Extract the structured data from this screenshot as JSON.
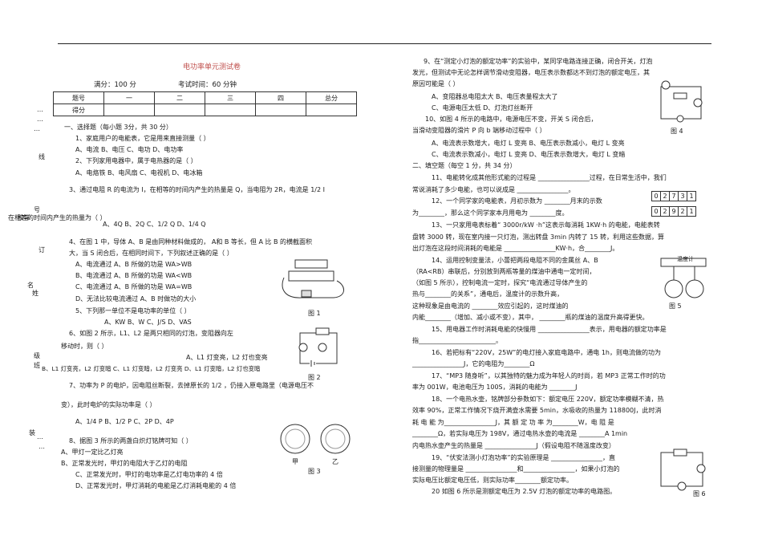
{
  "title": "电功率单元测试卷",
  "meta": {
    "score": "满分：100  分",
    "time": "考试时间：60 分钟"
  },
  "score_table": {
    "header": [
      "题号",
      "一",
      "二",
      "三",
      "四",
      "总分"
    ],
    "row": [
      "得分",
      "",
      "",
      "",
      "",
      ""
    ]
  },
  "binding": {
    "labels": [
      "线",
      "号",
      "订",
      "名",
      "姓",
      "级",
      "班",
      "装",
      "校学"
    ],
    "dots": "…"
  },
  "left_column": [
    "一、选择题（每小题  3分，共 30 分）",
    "1、家庭用户的电能表，它是用来直接测量（            ）",
    "A、电流              B、电压              C、电功              D、电功率",
    "2、下列家用电器中，属于电热器的是（         ）",
    "A、电烙铁            B、电风扇            C、电视机            D、电冰箱",
    "3、通过电阻 R 的电流为 I，在相等的时间内产生的热量是      Q，当电阻为 2R，电流是   1/2 I",
    "在相等的时间内产生的热量为（          ）",
    "A、4Q          B、2Q          C、1/2 Q          D、1/4 Q",
    "4、在图 1 中，导体 A、B 是由同种材料做成的，     A和 B 等长，但 A 比 B 的横截面积",
    "大，当 S 闭合后，在相同时间下，下列叙述正确的是（              ）",
    "A、电流通过  A、B 所做的功是 WA>WB",
    "B、电流通过  A、B 所做的功是 WA<WB",
    "C、电流通过  A、B 所做的功是 WA=WB",
    "D、无法比较电流通过  A、B 时做功的大小",
    "5、下列那一单位不是电功率的单位（          ）",
    "A、KW    B、W           C、J/S          D、VAS",
    "6、如图 2 所示，L1、L2 是两只相同的灯泡，变阻器向左",
    "移动时，则（          ）",
    "A、L1 灯变亮，L2 灯也变亮",
    "B、L1 灯变亮，L2 灯变暗      C、L1 灯变暗，L2 灯变亮      D、L1 灯变暗，L2 灯也变暗",
    "7、功率为  P 的电炉，因电阻丝断裂，去掉原长的       1/2 ，仍接入原电路里（电源电压不",
    "变），此时电炉的实际功率是（          ）",
    "A、1/4 P          B、1/2 P          C、2P          D、4P",
    "8、据图 3 所示的两盏白炽灯铭牌可知（          ）",
    "A、甲灯一定比乙灯亮",
    "B、正常发光时，甲灯的电阻大于乙灯的电阻",
    "C、正常发光时，甲灯的电功率是乙灯电功率的       4 倍",
    "D、正常发光时，甲灯消耗的电能是乙灯消耗电能的       4 倍"
  ],
  "right_column": [
    "9、在“测定小灯泡的额定功率”的实验中，某同学电路连接正确，闭合开关，灯泡",
    "发光，但测试中无论怎样调节滑动变阻器，电压表示数都达不到灯泡的额定电压，其",
    "原因可能是（          ）",
    "A、变阻器总电阻太大          B、电压表量程太大了",
    "C、电源电压太低              D、灯泡灯丝断开",
    "10、如图 4 所示的电路中，电源电压不变，开关    S 闭合后，",
    "当滑动变阻器的滑片  P 向 b 端移动过程中（          ）",
    "A、电流表示数增大，电灯  L 变亮              B、电压表示数减小，电灯  L 变亮",
    "C、电流表示数减小，电灯  L 变亮              D、电压表示数增大，电灯  L 变暗",
    "二、填空题（每空 1 分，共 34 分）",
    "11、电能转化成其他形式能的过程是  ________________过程，在日常生活中，我们",
    "常说消耗了多少电能，也可以说成是  ________________。",
    "12、一个同学家的电能表，月初示数为  ________月末的示数",
    "为________，那么这个同学家本月用电为  ________度。",
    "13、一只家用电表标着“  3000r/kW ·h”这表示每消耗   1KW·h 的电能，电能表转",
    "盘转 3000 转，现在室内接一只灯泡，测出转盘    3min  内转了  15 转，利用这些数据，算",
    "出灯泡在这段时间消耗的电能是  ________________KW·h，合________J。",
    "14、运用控制变量法，小蕾把两段电阻不同的金属丝     A、B",
    "（RA<RB）串联后，分别放到两瓶等量的煤油中通电一定时间，",
    "（如图 5 所示），控制电流一定时，探究“电流通过导体产生的",
    "热与________的关系”，通电后，温度计的示数升高，",
    "这种现象是由电流的  ________效应引起的，这时煤油的",
    "内能________（增加、减小或不变），其中，  ________瓶的煤油的温度升高得更快。",
    "15、用电器工作时消耗电能的快慢用  ________________表示，用电器的额定功率是",
    "指________________________。",
    "16、若把标有“220V，25W”的电灯接入家庭电路中，通电     1h，则电流做的功为",
    "________________J，它的电阻为________Ω",
    "17、“MP3 随身听”，以其独特的魅力成为年轻人的时尚，若       MP3  正常工作时的功",
    "率为 001W，电池电压为 100S，消耗的电能为  ________J",
    "18、一个电热水壶，铭牌部分参数如下：额定电压        220V，额定功率模糊不清，热",
    "效率 90%，正常工作情况下烧开满壶水需要    5min，水吸收的热量为  118800J，此时消",
    "耗 电 能 为________________J，其 额 定 功 率 为________W，电 阻 是",
    "________Ω，若实际电压为 198V，通过电热水壶的电流是  ________A 1min",
    "内电热水壶产生的热量是  ________________J（假设电阻不随温度改变）",
    "19、“伏安法测小灯泡功率”的实验原理是  ________________，直",
    "接测量的物理量是  ________________和________________，如果小灯泡的",
    "实际电压比额定电压低，则实际功率________额定功率。",
    "20 如图 6 所示是测额定电压为   2.5V 灯泡的额定功率的电路图。"
  ],
  "meter_digits": [
    "0",
    "2",
    "7",
    "3",
    "1"
  ],
  "meter_digits_end": [
    "0",
    "2",
    "9",
    "2",
    "1"
  ],
  "figures": {
    "fig1": "图 1",
    "fig2": "图 2",
    "fig3": "图 3",
    "fig3_lamp1": "甲",
    "fig3_lamp2": "乙",
    "fig4": "图 4",
    "fig5": "图 5",
    "fig5_label": "温度计",
    "fig6": "图 6"
  }
}
